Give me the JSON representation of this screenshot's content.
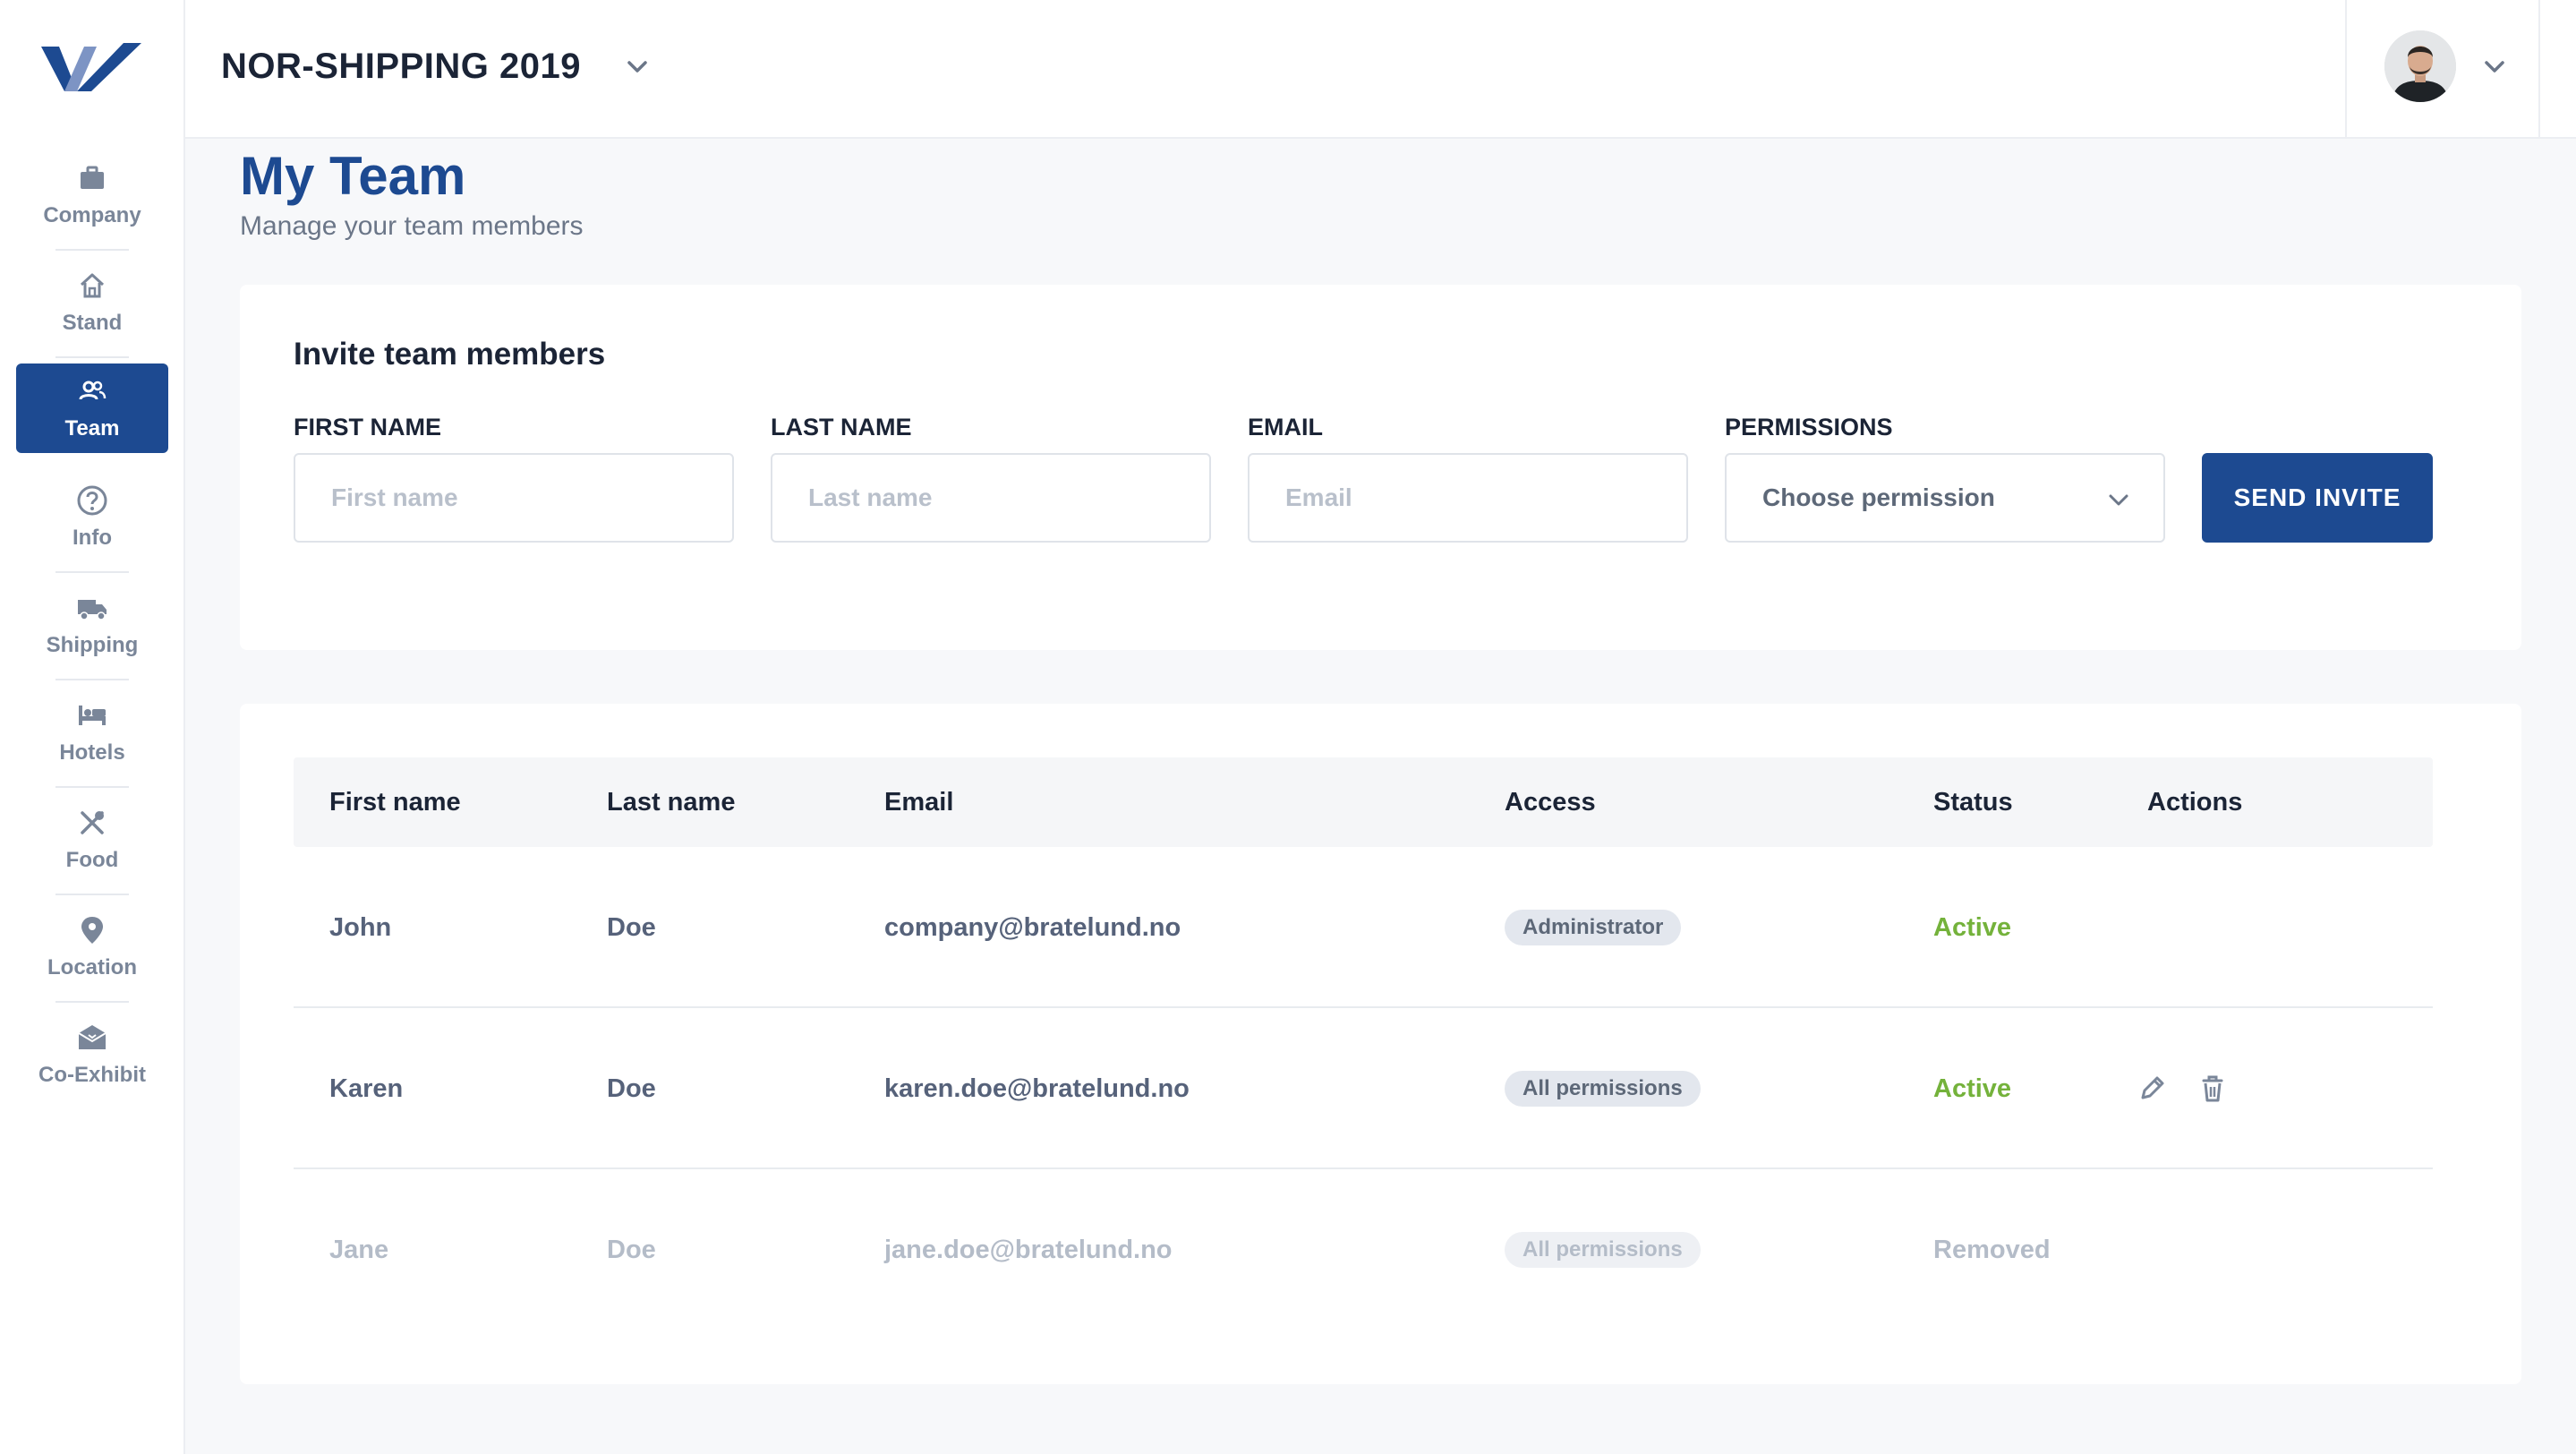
{
  "sidebar": {
    "items": [
      {
        "label": "Company",
        "icon": "briefcase-icon"
      },
      {
        "label": "Stand",
        "icon": "home-icon"
      },
      {
        "label": "Team",
        "icon": "users-icon",
        "active": true
      },
      {
        "label": "Info",
        "icon": "question-circle-icon"
      },
      {
        "label": "Shipping",
        "icon": "truck-icon"
      },
      {
        "label": "Hotels",
        "icon": "bed-icon"
      },
      {
        "label": "Food",
        "icon": "utensils-icon"
      },
      {
        "label": "Location",
        "icon": "map-pin-icon"
      },
      {
        "label": "Co-Exhibit",
        "icon": "box-open-icon"
      }
    ]
  },
  "header": {
    "event_title": "NOR-SHIPPING 2019"
  },
  "page": {
    "title": "My Team",
    "subtitle": "Manage your team members"
  },
  "invite": {
    "title": "Invite team members",
    "first_name_label": "FIRST NAME",
    "first_name_placeholder": "First name",
    "last_name_label": "LAST NAME",
    "last_name_placeholder": "Last name",
    "email_label": "EMAIL",
    "email_placeholder": "Email",
    "permissions_label": "PERMISSIONS",
    "permissions_value": "Choose permission",
    "send_label": "SEND INVITE"
  },
  "table": {
    "columns": {
      "first_name": "First name",
      "last_name": "Last name",
      "email": "Email",
      "access": "Access",
      "status": "Status",
      "actions": "Actions"
    },
    "rows": [
      {
        "first_name": "John",
        "last_name": "Doe",
        "email": "company@bratelund.no",
        "access": "Administrator",
        "status": "Active"
      },
      {
        "first_name": "Karen",
        "last_name": "Doe",
        "email": "karen.doe@bratelund.no",
        "access": "All permissions",
        "status": "Active"
      },
      {
        "first_name": "Jane",
        "last_name": "Doe",
        "email": "jane.doe@bratelund.no",
        "access": "All permissions",
        "status": "Removed"
      }
    ]
  },
  "colors": {
    "primary": "#1d4a91",
    "active_status": "#74b23b",
    "muted": "#b4bcc8"
  }
}
